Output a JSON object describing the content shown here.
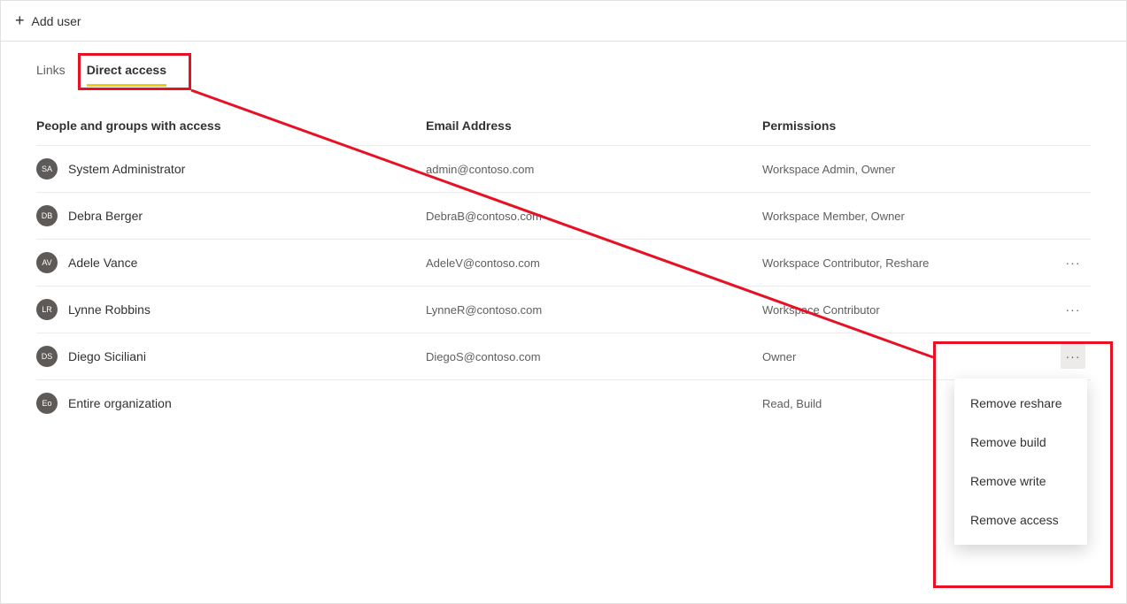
{
  "toolbar": {
    "add_user_label": "Add user"
  },
  "tabs": {
    "links": "Links",
    "direct_access": "Direct access"
  },
  "headers": {
    "people": "People and groups with access",
    "email": "Email Address",
    "permissions": "Permissions"
  },
  "rows": [
    {
      "initials": "SA",
      "name": "System Administrator",
      "email": "admin@contoso.com",
      "perm": "Workspace Admin, Owner",
      "more": false
    },
    {
      "initials": "DB",
      "name": "Debra Berger",
      "email": "DebraB@contoso.com",
      "perm": "Workspace Member, Owner",
      "more": false
    },
    {
      "initials": "AV",
      "name": "Adele Vance",
      "email": "AdeleV@contoso.com",
      "perm": "Workspace Contributor, Reshare",
      "more": true
    },
    {
      "initials": "LR",
      "name": "Lynne Robbins",
      "email": "LynneR@contoso.com",
      "perm": "Workspace Contributor",
      "more": true
    },
    {
      "initials": "DS",
      "name": "Diego Siciliani",
      "email": "DiegoS@contoso.com",
      "perm": "Owner",
      "more": true,
      "highlight": true
    },
    {
      "initials": "Eo",
      "name": "Entire organization",
      "email": "",
      "perm": "Read, Build",
      "more": false
    }
  ],
  "menu": {
    "items": [
      "Remove reshare",
      "Remove build",
      "Remove write",
      "Remove access"
    ]
  }
}
